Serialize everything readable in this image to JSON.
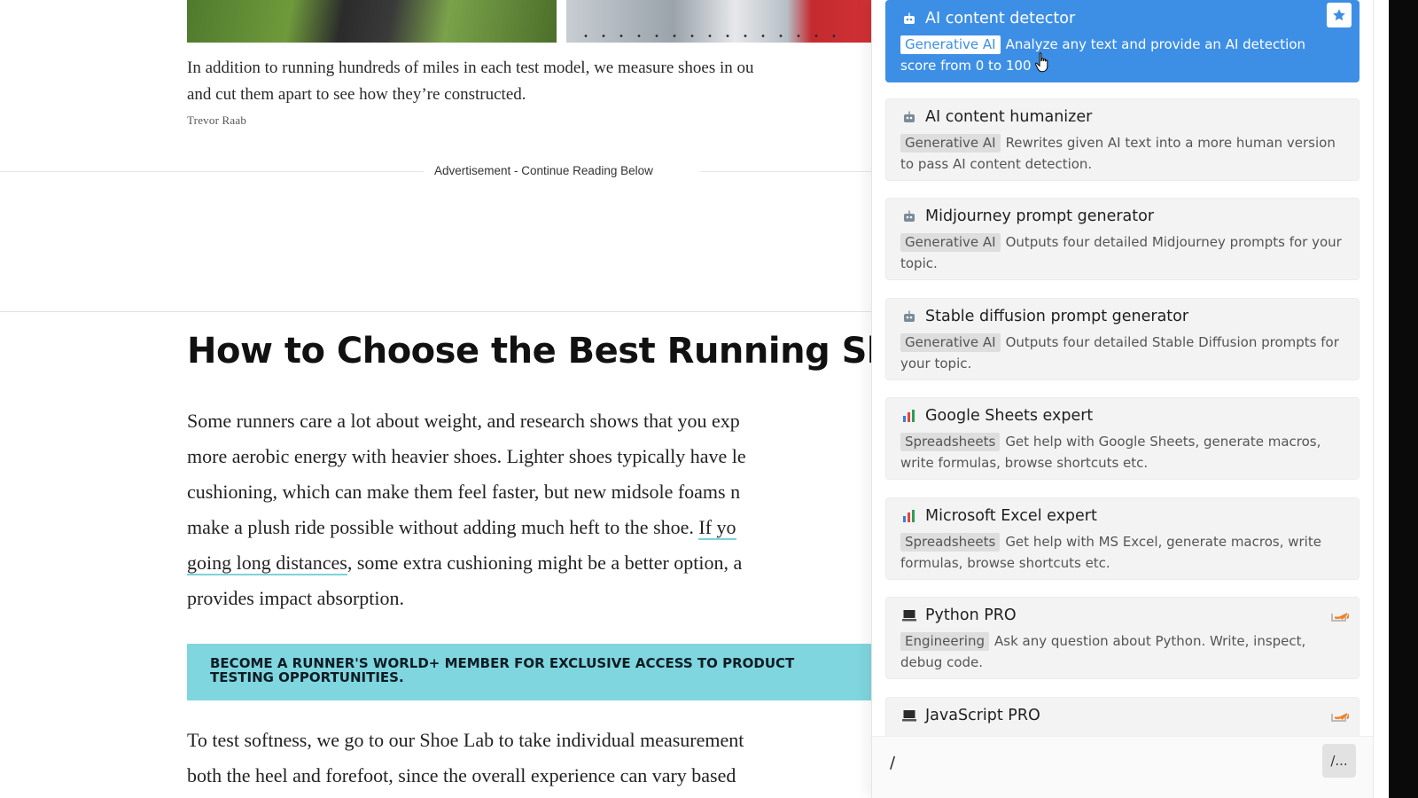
{
  "article": {
    "caption": "In addition to running hundreds of miles in each test model, we measure shoes in our Shoe Lab and cut them apart to see how they’re constructed.",
    "caption_line1": "In addition to running hundreds of miles in each test model, we measure shoes in ou",
    "caption_line2": "and cut them apart to see how they’re constructed.",
    "credit": "Trevor Raab",
    "ad_label": "Advertisement - Continue Reading Below",
    "heading": "How to Choose the Best Running Shoe",
    "para1": {
      "l1": "Some runners care a lot about weight, and research shows that you exp",
      "l2": "more aerobic energy with heavier shoes. Lighter shoes typically have le",
      "l3": "cushioning, which can make them feel faster, but new midsole foams n",
      "l4a": "make a plush ride possible without adding much heft to the shoe. ",
      "l4_link": "If yo",
      "l5_link": "going long distances",
      "l5b": ", some extra cushioning might be a better option, a",
      "l6": "provides impact absorption."
    },
    "promo": "BECOME A RUNNER'S WORLD+ MEMBER FOR EXCLUSIVE ACCESS TO PRODUCT TESTING OPPORTUNITIES.",
    "para2": {
      "l1": "To test softness, we go to our Shoe Lab to take individual measurement",
      "l2": "both the heel and forefoot, since the overall experience can vary based"
    }
  },
  "panel": {
    "cards": [
      {
        "title": "AI content detector",
        "tag": "Generative AI",
        "desc": "Analyze any text and provide an AI detection score from 0 to 100",
        "icon": "robot-icon",
        "corner": "star-icon",
        "selected": true
      },
      {
        "title": "AI content humanizer",
        "tag": "Generative AI",
        "desc": "Rewrites given AI text into a more human version to pass AI content detection.",
        "icon": "robot-icon"
      },
      {
        "title": "Midjourney prompt generator",
        "tag": "Generative AI",
        "desc": "Outputs four detailed Midjourney prompts for your topic.",
        "icon": "robot-icon"
      },
      {
        "title": "Stable diffusion prompt generator",
        "tag": "Generative AI",
        "desc": "Outputs four detailed Stable Diffusion prompts for your topic.",
        "icon": "robot-icon"
      },
      {
        "title": "Google Sheets expert",
        "tag": "Spreadsheets",
        "desc": "Get help with Google Sheets, generate macros, write formulas, browse shortcuts etc.",
        "icon": "bar-chart-icon"
      },
      {
        "title": "Microsoft Excel expert",
        "tag": "Spreadsheets",
        "desc": "Get help with MS Excel, generate macros, write formulas, browse shortcuts etc.",
        "icon": "bar-chart-icon"
      },
      {
        "title": "Python PRO",
        "tag": "Engineering",
        "desc": "Ask any question about Python. Write, inspect, debug code.",
        "icon": "laptop-icon",
        "corner": "stackoverflow-icon"
      },
      {
        "title": "JavaScript PRO",
        "tag": "Engineering",
        "desc": "",
        "icon": "laptop-icon",
        "corner": "stackoverflow-icon"
      }
    ],
    "input_value": "/",
    "slash_button": "/..."
  },
  "colors": {
    "selected": "#3d8fe6",
    "promo": "#7fd6de",
    "link_underline": "#7dd3d8"
  }
}
